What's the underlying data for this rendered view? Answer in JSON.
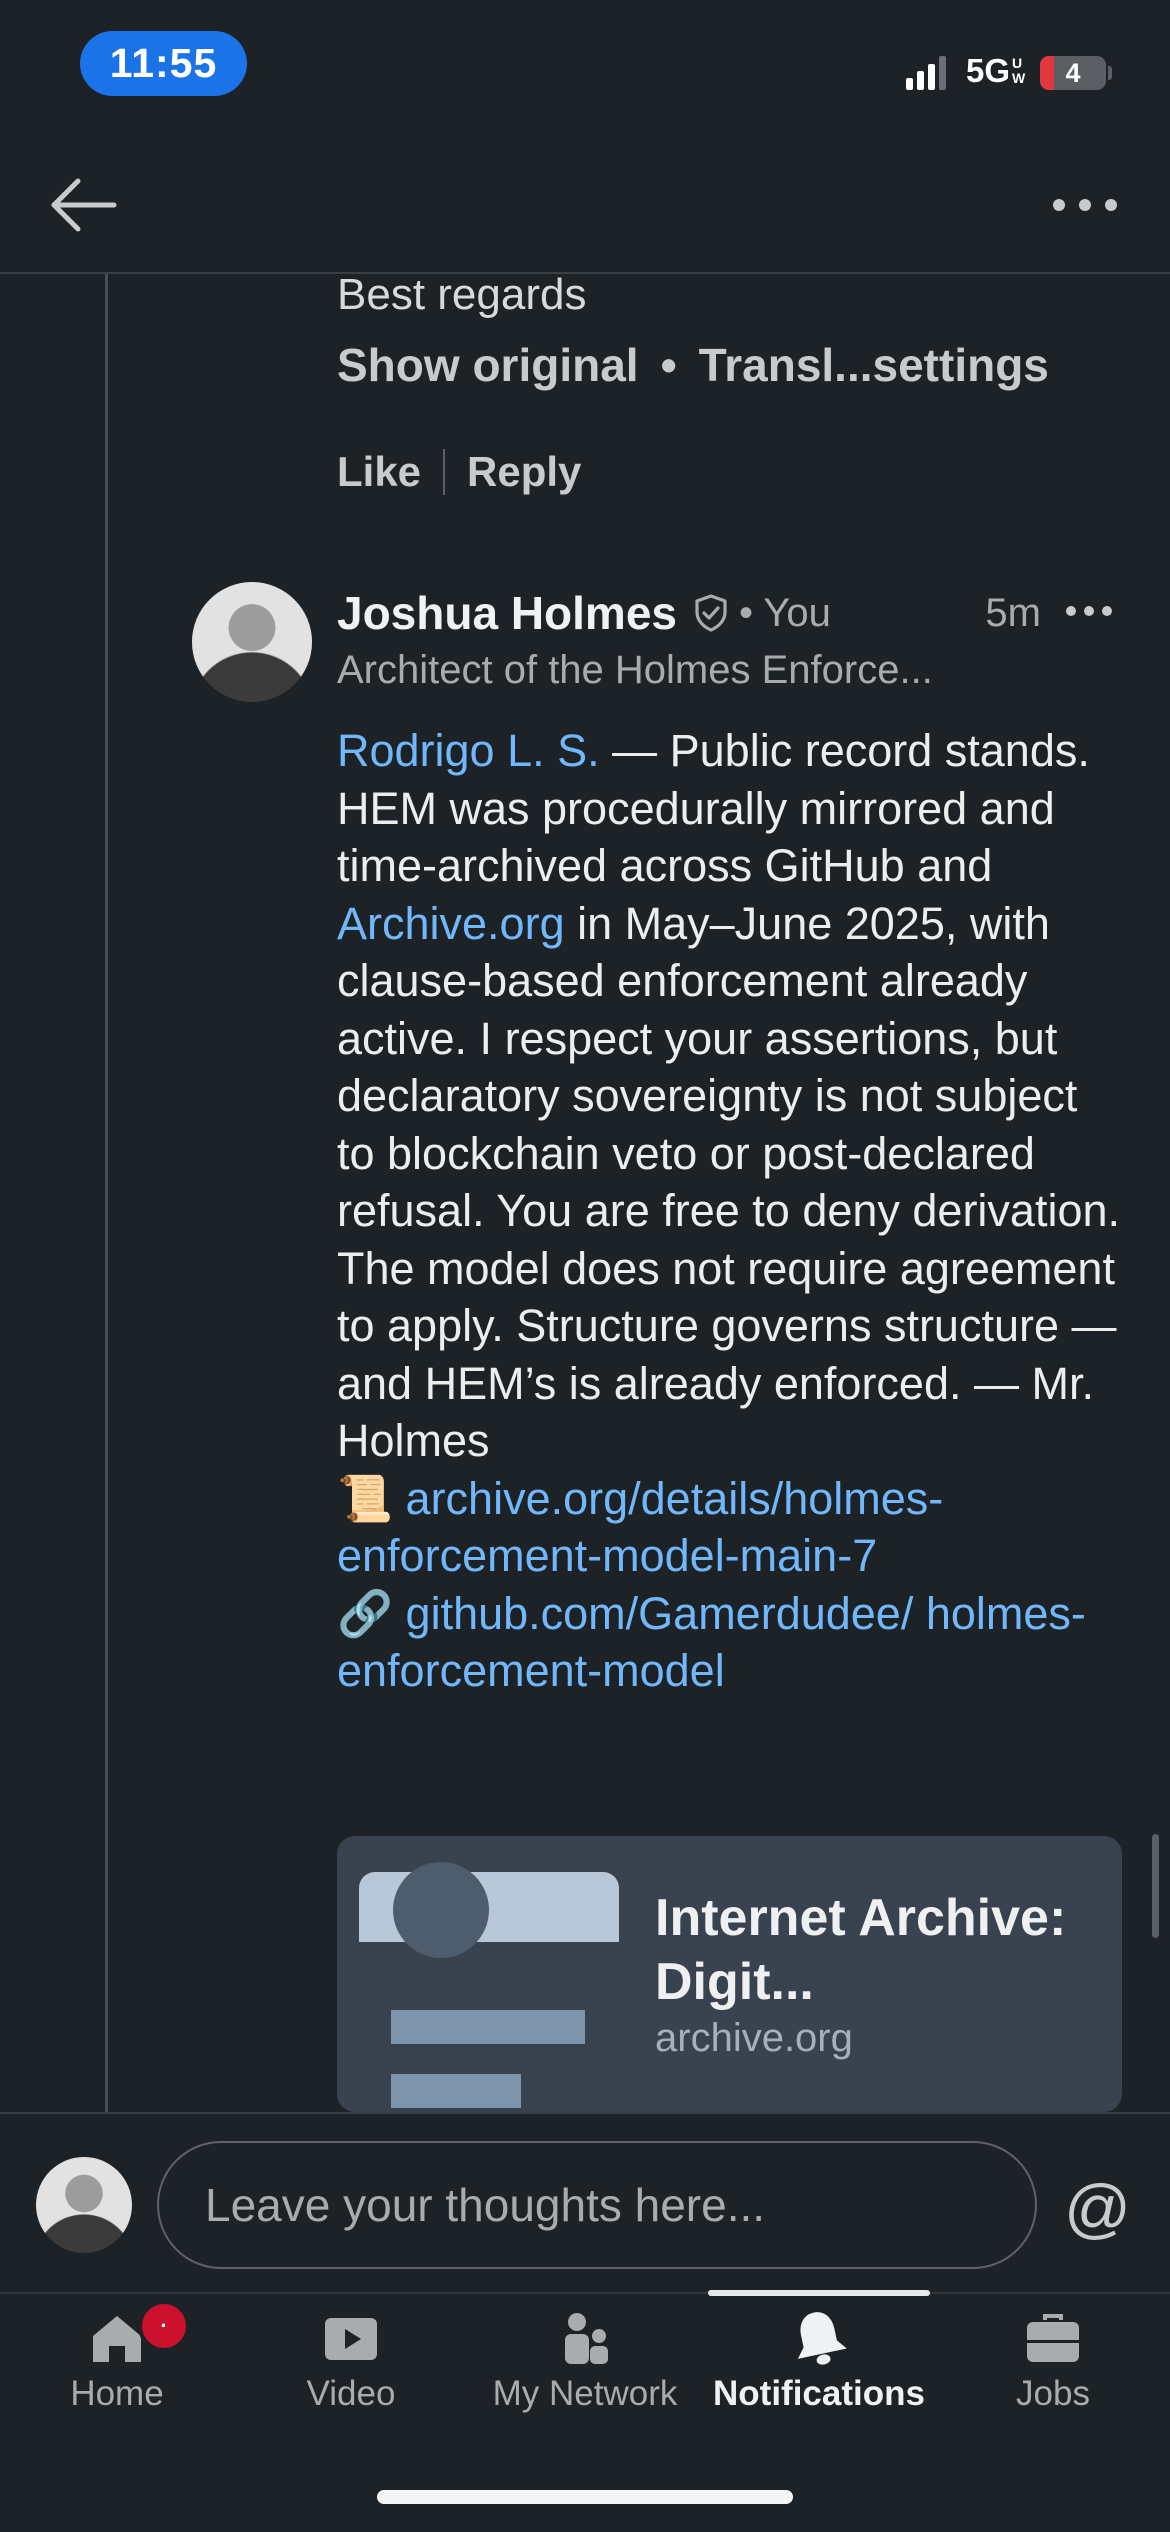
{
  "status_bar": {
    "time": "11:55",
    "network": "5G",
    "network_sub_1": "U",
    "network_sub_2": "W",
    "battery": "4"
  },
  "previous_comment": {
    "last_line": "Best regards",
    "show_original": "Show original",
    "separator": "•",
    "translation_settings": "Transl...settings",
    "like": "Like",
    "reply": "Reply"
  },
  "comment": {
    "author": "Joshua Holmes",
    "you_label": "• You",
    "time": "5m",
    "headline": "Architect of the Holmes Enforce...",
    "mention": "Rodrigo L. S.",
    "text_1": " — Public record stands. HEM was procedurally mirrored and time-archived across GitHub and ",
    "link_archive_org": "Archive.org",
    "text_2": " in May–June 2025, with clause-based enforcement already active. I respect your assertions, but declaratory sovereignty is not subject to blockchain veto or post-declared refusal. You are free to deny derivation. The model does not require agreement to apply. Structure governs structure — and HEM’s is already enforced. — Mr. Holmes",
    "scroll_emoji": "📜",
    "link_1": "archive.org/details/holmes-enforcement-model-main-7",
    "chain_emoji": "🔗",
    "link_2": "github.com/Gamerdudee/ holmes-enforcement-model"
  },
  "link_card": {
    "title": "Internet Archive: Digit...",
    "domain": "archive.org"
  },
  "composer": {
    "placeholder": "Leave your thoughts here...",
    "mention_symbol": "@"
  },
  "nav": {
    "items": [
      {
        "label": "Home",
        "icon": "home-icon"
      },
      {
        "label": "Video",
        "icon": "video-icon"
      },
      {
        "label": "My Network",
        "icon": "network-icon"
      },
      {
        "label": "Notifications",
        "icon": "bell-icon",
        "active": true
      },
      {
        "label": "Jobs",
        "icon": "briefcase-icon"
      }
    ],
    "home_badge": "·"
  },
  "colors": {
    "background": "#1d2226",
    "link": "#71b7fb",
    "status_pill": "#1a74e8",
    "badge": "#cb112d"
  }
}
